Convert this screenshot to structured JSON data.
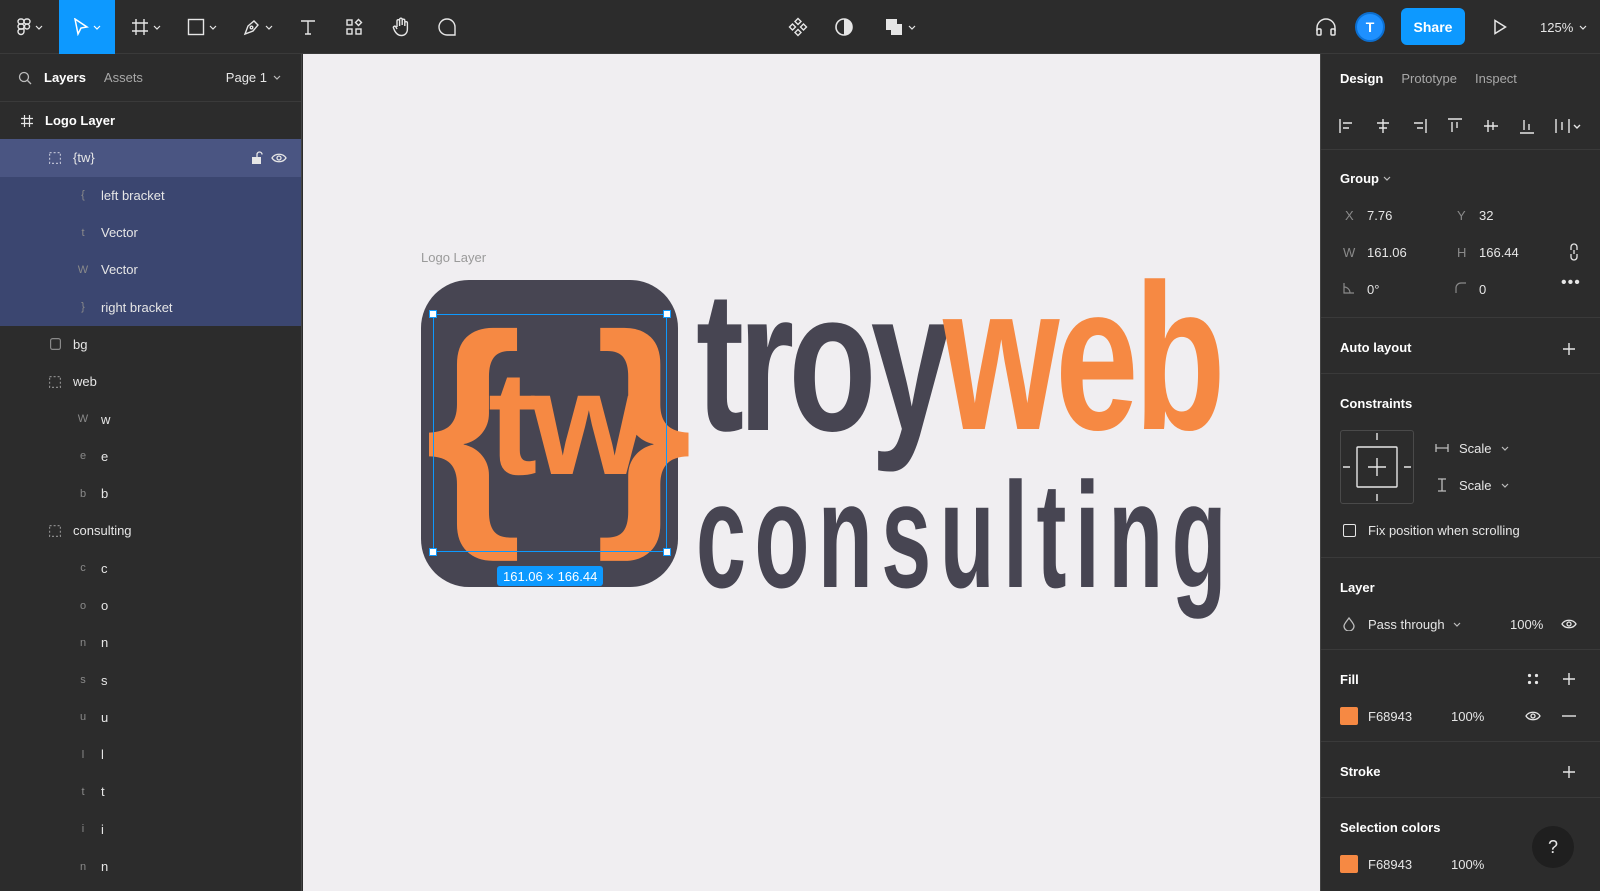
{
  "toolbar": {
    "share_label": "Share",
    "zoom_level": "125%",
    "avatar_initial": "T"
  },
  "left_panel": {
    "tab_layers": "Layers",
    "tab_assets": "Assets",
    "page_label": "Page 1",
    "layers": [
      {
        "label": "Logo Layer",
        "icon": "frame-icon"
      },
      {
        "label": "{tw}",
        "icon": "group-icon"
      },
      {
        "label": "left bracket",
        "icon": "vector-icon"
      },
      {
        "label": "Vector",
        "icon": "vector-icon"
      },
      {
        "label": "Vector",
        "icon": "vector-icon"
      },
      {
        "label": "right bracket",
        "icon": "vector-icon"
      },
      {
        "label": "bg",
        "icon": "rectangle-icon"
      },
      {
        "label": "web",
        "icon": "group-icon"
      },
      {
        "label": "w",
        "icon": "vector-icon"
      },
      {
        "label": "e",
        "icon": "vector-icon"
      },
      {
        "label": "b",
        "icon": "vector-icon"
      },
      {
        "label": "consulting",
        "icon": "group-icon"
      },
      {
        "label": "c",
        "icon": "vector-icon"
      },
      {
        "label": "o",
        "icon": "vector-icon"
      },
      {
        "label": "n",
        "icon": "vector-icon"
      },
      {
        "label": "s",
        "icon": "vector-icon"
      },
      {
        "label": "u",
        "icon": "vector-icon"
      },
      {
        "label": "l",
        "icon": "vector-icon"
      },
      {
        "label": "t",
        "icon": "vector-icon"
      },
      {
        "label": "i",
        "icon": "vector-icon"
      },
      {
        "label": "n",
        "icon": "vector-icon"
      }
    ]
  },
  "canvas": {
    "frame_label": "Logo Layer",
    "selection_size": "161.06 × 166.44",
    "logo": {
      "tw": "tw",
      "left_bracket": "{",
      "right_bracket": "}",
      "word1": "troy",
      "word2": "web",
      "word3": "consulting"
    }
  },
  "right_panel": {
    "tabs": [
      "Design",
      "Prototype",
      "Inspect"
    ],
    "group_label": "Group",
    "x_label": "X",
    "x_value": "7.76",
    "y_label": "Y",
    "y_value": "32",
    "w_label": "W",
    "w_value": "161.06",
    "h_label": "H",
    "h_value": "166.44",
    "rotation_value": "0°",
    "radius_value": "0",
    "auto_layout_label": "Auto layout",
    "constraints_label": "Constraints",
    "constraint_h": "Scale",
    "constraint_v": "Scale",
    "fix_position_label": "Fix position when scrolling",
    "layer_label": "Layer",
    "blend_mode": "Pass through",
    "layer_opacity": "100%",
    "fill_label": "Fill",
    "fill_hex": "F68943",
    "fill_opacity": "100%",
    "stroke_label": "Stroke",
    "selection_colors_label": "Selection colors",
    "sel_color_hex": "F68943",
    "sel_color_opacity": "100%",
    "help_label": "?"
  },
  "colors": {
    "accent": "#0d99ff",
    "brand_orange": "#f68943",
    "brand_dark": "#474552"
  }
}
